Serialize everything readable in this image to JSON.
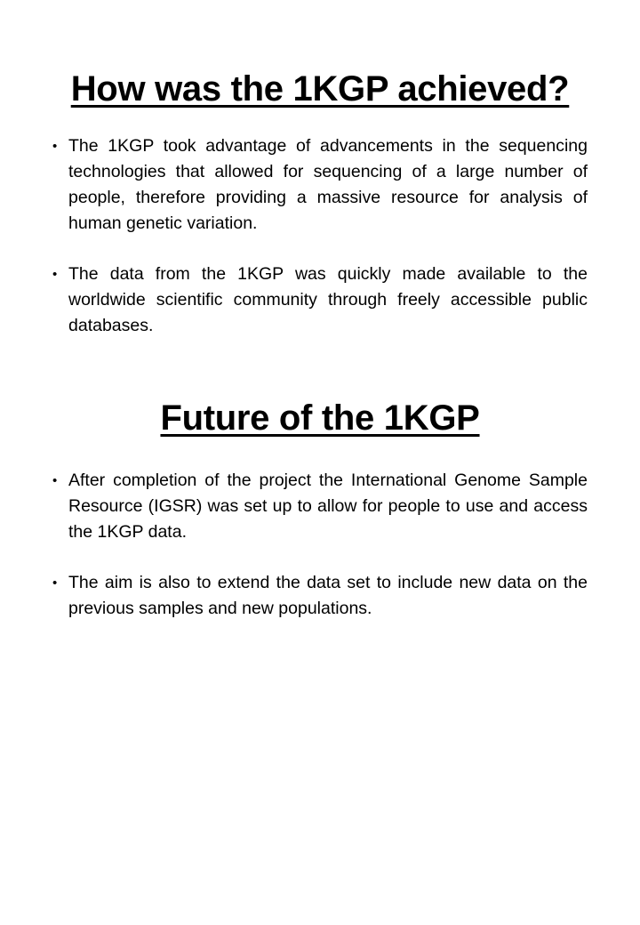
{
  "section1": {
    "heading": "How was the 1KGP achieved?",
    "bullets": [
      "The 1KGP took advantage of advancements in the sequencing technologies that allowed for sequencing of a large number of people, therefore providing a massive resource for analysis of human genetic variation.",
      "The data from the 1KGP was quickly made available to the worldwide scientific community through freely accessible public databases."
    ]
  },
  "section2": {
    "heading": "Future of the 1KGP",
    "bullets": [
      "After completion of the project the International Genome Sample Resource (IGSR) was set up to allow for people to use and access the 1KGP data.",
      "The aim is also to extend the data set to include new data on the previous samples and new populations."
    ]
  },
  "bullet_symbol": "•"
}
